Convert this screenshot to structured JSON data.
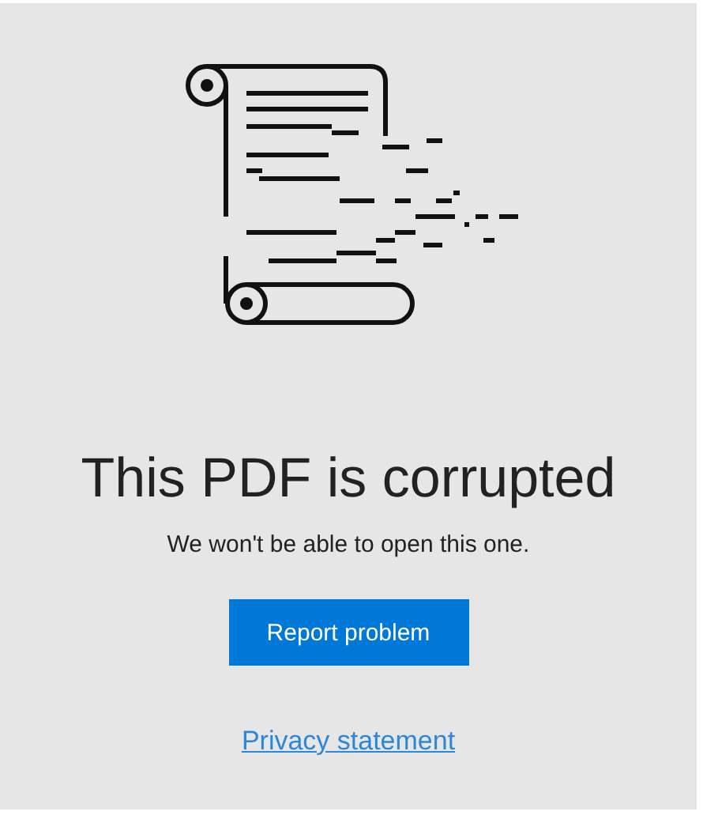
{
  "title": "This PDF is corrupted",
  "message": "We won't be able to open this one.",
  "button": "Report problem",
  "link": "Privacy statement"
}
